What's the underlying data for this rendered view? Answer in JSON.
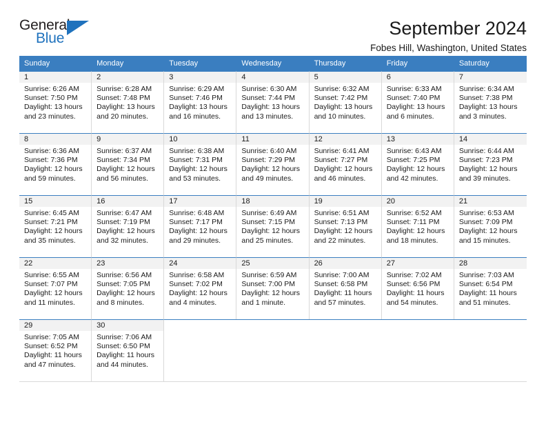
{
  "brand": {
    "name_top": "General",
    "name_bottom": "Blue",
    "color_top": "#231f20",
    "color_blue": "#1f72bd"
  },
  "header": {
    "title": "September 2024",
    "location": "Fobes Hill, Washington, United States"
  },
  "calendar": {
    "header_bg": "#3a7ec0",
    "daynum_bg": "#f2f2f2",
    "weekdays": [
      "Sunday",
      "Monday",
      "Tuesday",
      "Wednesday",
      "Thursday",
      "Friday",
      "Saturday"
    ],
    "weeks": [
      [
        {
          "day": "1",
          "sunrise": "Sunrise: 6:26 AM",
          "sunset": "Sunset: 7:50 PM",
          "daylight_line1": "Daylight: 13 hours",
          "daylight_line2": "and 23 minutes."
        },
        {
          "day": "2",
          "sunrise": "Sunrise: 6:28 AM",
          "sunset": "Sunset: 7:48 PM",
          "daylight_line1": "Daylight: 13 hours",
          "daylight_line2": "and 20 minutes."
        },
        {
          "day": "3",
          "sunrise": "Sunrise: 6:29 AM",
          "sunset": "Sunset: 7:46 PM",
          "daylight_line1": "Daylight: 13 hours",
          "daylight_line2": "and 16 minutes."
        },
        {
          "day": "4",
          "sunrise": "Sunrise: 6:30 AM",
          "sunset": "Sunset: 7:44 PM",
          "daylight_line1": "Daylight: 13 hours",
          "daylight_line2": "and 13 minutes."
        },
        {
          "day": "5",
          "sunrise": "Sunrise: 6:32 AM",
          "sunset": "Sunset: 7:42 PM",
          "daylight_line1": "Daylight: 13 hours",
          "daylight_line2": "and 10 minutes."
        },
        {
          "day": "6",
          "sunrise": "Sunrise: 6:33 AM",
          "sunset": "Sunset: 7:40 PM",
          "daylight_line1": "Daylight: 13 hours",
          "daylight_line2": "and 6 minutes."
        },
        {
          "day": "7",
          "sunrise": "Sunrise: 6:34 AM",
          "sunset": "Sunset: 7:38 PM",
          "daylight_line1": "Daylight: 13 hours",
          "daylight_line2": "and 3 minutes."
        }
      ],
      [
        {
          "day": "8",
          "sunrise": "Sunrise: 6:36 AM",
          "sunset": "Sunset: 7:36 PM",
          "daylight_line1": "Daylight: 12 hours",
          "daylight_line2": "and 59 minutes."
        },
        {
          "day": "9",
          "sunrise": "Sunrise: 6:37 AM",
          "sunset": "Sunset: 7:34 PM",
          "daylight_line1": "Daylight: 12 hours",
          "daylight_line2": "and 56 minutes."
        },
        {
          "day": "10",
          "sunrise": "Sunrise: 6:38 AM",
          "sunset": "Sunset: 7:31 PM",
          "daylight_line1": "Daylight: 12 hours",
          "daylight_line2": "and 53 minutes."
        },
        {
          "day": "11",
          "sunrise": "Sunrise: 6:40 AM",
          "sunset": "Sunset: 7:29 PM",
          "daylight_line1": "Daylight: 12 hours",
          "daylight_line2": "and 49 minutes."
        },
        {
          "day": "12",
          "sunrise": "Sunrise: 6:41 AM",
          "sunset": "Sunset: 7:27 PM",
          "daylight_line1": "Daylight: 12 hours",
          "daylight_line2": "and 46 minutes."
        },
        {
          "day": "13",
          "sunrise": "Sunrise: 6:43 AM",
          "sunset": "Sunset: 7:25 PM",
          "daylight_line1": "Daylight: 12 hours",
          "daylight_line2": "and 42 minutes."
        },
        {
          "day": "14",
          "sunrise": "Sunrise: 6:44 AM",
          "sunset": "Sunset: 7:23 PM",
          "daylight_line1": "Daylight: 12 hours",
          "daylight_line2": "and 39 minutes."
        }
      ],
      [
        {
          "day": "15",
          "sunrise": "Sunrise: 6:45 AM",
          "sunset": "Sunset: 7:21 PM",
          "daylight_line1": "Daylight: 12 hours",
          "daylight_line2": "and 35 minutes."
        },
        {
          "day": "16",
          "sunrise": "Sunrise: 6:47 AM",
          "sunset": "Sunset: 7:19 PM",
          "daylight_line1": "Daylight: 12 hours",
          "daylight_line2": "and 32 minutes."
        },
        {
          "day": "17",
          "sunrise": "Sunrise: 6:48 AM",
          "sunset": "Sunset: 7:17 PM",
          "daylight_line1": "Daylight: 12 hours",
          "daylight_line2": "and 29 minutes."
        },
        {
          "day": "18",
          "sunrise": "Sunrise: 6:49 AM",
          "sunset": "Sunset: 7:15 PM",
          "daylight_line1": "Daylight: 12 hours",
          "daylight_line2": "and 25 minutes."
        },
        {
          "day": "19",
          "sunrise": "Sunrise: 6:51 AM",
          "sunset": "Sunset: 7:13 PM",
          "daylight_line1": "Daylight: 12 hours",
          "daylight_line2": "and 22 minutes."
        },
        {
          "day": "20",
          "sunrise": "Sunrise: 6:52 AM",
          "sunset": "Sunset: 7:11 PM",
          "daylight_line1": "Daylight: 12 hours",
          "daylight_line2": "and 18 minutes."
        },
        {
          "day": "21",
          "sunrise": "Sunrise: 6:53 AM",
          "sunset": "Sunset: 7:09 PM",
          "daylight_line1": "Daylight: 12 hours",
          "daylight_line2": "and 15 minutes."
        }
      ],
      [
        {
          "day": "22",
          "sunrise": "Sunrise: 6:55 AM",
          "sunset": "Sunset: 7:07 PM",
          "daylight_line1": "Daylight: 12 hours",
          "daylight_line2": "and 11 minutes."
        },
        {
          "day": "23",
          "sunrise": "Sunrise: 6:56 AM",
          "sunset": "Sunset: 7:05 PM",
          "daylight_line1": "Daylight: 12 hours",
          "daylight_line2": "and 8 minutes."
        },
        {
          "day": "24",
          "sunrise": "Sunrise: 6:58 AM",
          "sunset": "Sunset: 7:02 PM",
          "daylight_line1": "Daylight: 12 hours",
          "daylight_line2": "and 4 minutes."
        },
        {
          "day": "25",
          "sunrise": "Sunrise: 6:59 AM",
          "sunset": "Sunset: 7:00 PM",
          "daylight_line1": "Daylight: 12 hours",
          "daylight_line2": "and 1 minute."
        },
        {
          "day": "26",
          "sunrise": "Sunrise: 7:00 AM",
          "sunset": "Sunset: 6:58 PM",
          "daylight_line1": "Daylight: 11 hours",
          "daylight_line2": "and 57 minutes."
        },
        {
          "day": "27",
          "sunrise": "Sunrise: 7:02 AM",
          "sunset": "Sunset: 6:56 PM",
          "daylight_line1": "Daylight: 11 hours",
          "daylight_line2": "and 54 minutes."
        },
        {
          "day": "28",
          "sunrise": "Sunrise: 7:03 AM",
          "sunset": "Sunset: 6:54 PM",
          "daylight_line1": "Daylight: 11 hours",
          "daylight_line2": "and 51 minutes."
        }
      ],
      [
        {
          "day": "29",
          "sunrise": "Sunrise: 7:05 AM",
          "sunset": "Sunset: 6:52 PM",
          "daylight_line1": "Daylight: 11 hours",
          "daylight_line2": "and 47 minutes."
        },
        {
          "day": "30",
          "sunrise": "Sunrise: 7:06 AM",
          "sunset": "Sunset: 6:50 PM",
          "daylight_line1": "Daylight: 11 hours",
          "daylight_line2": "and 44 minutes."
        },
        {
          "day": "",
          "sunrise": "",
          "sunset": "",
          "daylight_line1": "",
          "daylight_line2": ""
        },
        {
          "day": "",
          "sunrise": "",
          "sunset": "",
          "daylight_line1": "",
          "daylight_line2": ""
        },
        {
          "day": "",
          "sunrise": "",
          "sunset": "",
          "daylight_line1": "",
          "daylight_line2": ""
        },
        {
          "day": "",
          "sunrise": "",
          "sunset": "",
          "daylight_line1": "",
          "daylight_line2": ""
        },
        {
          "day": "",
          "sunrise": "",
          "sunset": "",
          "daylight_line1": "",
          "daylight_line2": ""
        }
      ]
    ]
  }
}
